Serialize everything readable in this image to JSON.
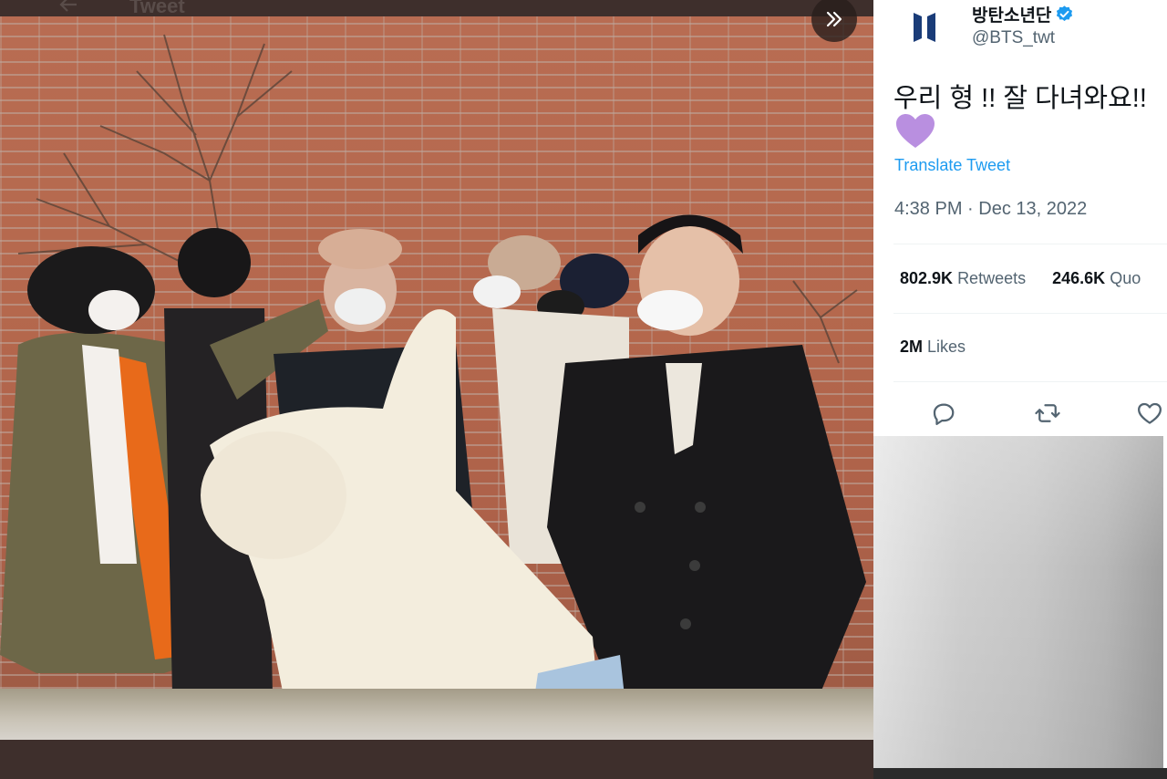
{
  "media": {
    "page_title": "Tweet",
    "expand_icon": "double-chevron-right-icon",
    "back_icon": "arrow-left-icon"
  },
  "tweet": {
    "author": {
      "display_name": "방탄소년단",
      "handle": "@BTS_twt",
      "verified": true,
      "avatar_icon": "bts-logo-icon"
    },
    "text": "우리 형 !! 잘 다녀와요!!",
    "emoji": "purple-heart-icon",
    "translate_label": "Translate Tweet",
    "timestamp": "4:38 PM · Dec 13, 2022",
    "stats": {
      "retweets_count": "802.9K",
      "retweets_label": "Retweets",
      "quotes_count": "246.6K",
      "quotes_label": "Quo",
      "likes_count": "2M",
      "likes_label": "Likes"
    },
    "actions": [
      "reply-icon",
      "retweet-icon",
      "like-icon"
    ]
  },
  "colors": {
    "link": "#1d9bf0",
    "text_primary": "#0f1419",
    "text_secondary": "#536471",
    "verified": "#1d9bf0",
    "heart": "#b98fe0",
    "viewer_bg": "#3e2f2c"
  }
}
